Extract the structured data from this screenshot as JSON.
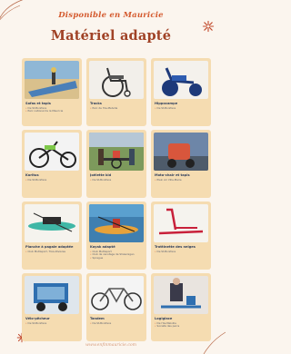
{
  "header": {
    "subtitle": "Disponible en Mauricie",
    "title": "Matériel adapté"
  },
  "cards": [
    {
      "name": "Sofas et tapis",
      "details": [
        "De St-Boniface",
        "Parc national de la Mauricie"
      ],
      "icon": "beach-mat-image"
    },
    {
      "name": "Tracks",
      "details": [
        "Parc de l'Île-Melville"
      ],
      "icon": "wheelchair-image"
    },
    {
      "name": "Hippocampe",
      "details": [
        "De St-Boniface"
      ],
      "icon": "beach-wheelchair-image"
    },
    {
      "name": "Karitus",
      "details": [
        "De St-Boniface"
      ],
      "icon": "handbike-image"
    },
    {
      "name": "Joëlette kid",
      "details": [
        "De St-Boniface"
      ],
      "icon": "joelette-image"
    },
    {
      "name": "Moto-chair et tapis",
      "details": [
        "Plein Air Ville-Marie"
      ],
      "icon": "moto-chair-image"
    },
    {
      "name": "Planche à pagaie adaptée",
      "details": [
        "Club Multisport, Trois-Rivières"
      ],
      "icon": "paddleboard-image"
    },
    {
      "name": "Kayak adapté",
      "details": [
        "Club Multisport",
        "Club de canotage de Shawinigan",
        "Sprague"
      ],
      "icon": "kayak-image"
    },
    {
      "name": "Trottinette des neiges",
      "details": [
        "De St-Boniface"
      ],
      "icon": "snow-scooter-image"
    },
    {
      "name": "Vélo-pêcheur",
      "details": [
        "De St-Boniface"
      ],
      "icon": "trailer-image"
    },
    {
      "name": "Tandem",
      "details": [
        "De St-Boniface"
      ],
      "icon": "tandem-bike-image"
    },
    {
      "name": "Logiglace",
      "details": [
        "De l'Île-Melville",
        "Société des parcs"
      ],
      "icon": "ice-sled-image"
    }
  ],
  "footer": {
    "url": "www.enfinmauricie.com"
  },
  "colors": {
    "background": "#fbf5ee",
    "card": "#f5dcb1",
    "title": "#a04226",
    "subtitle": "#d45a2e",
    "name": "#2d3d5c"
  }
}
